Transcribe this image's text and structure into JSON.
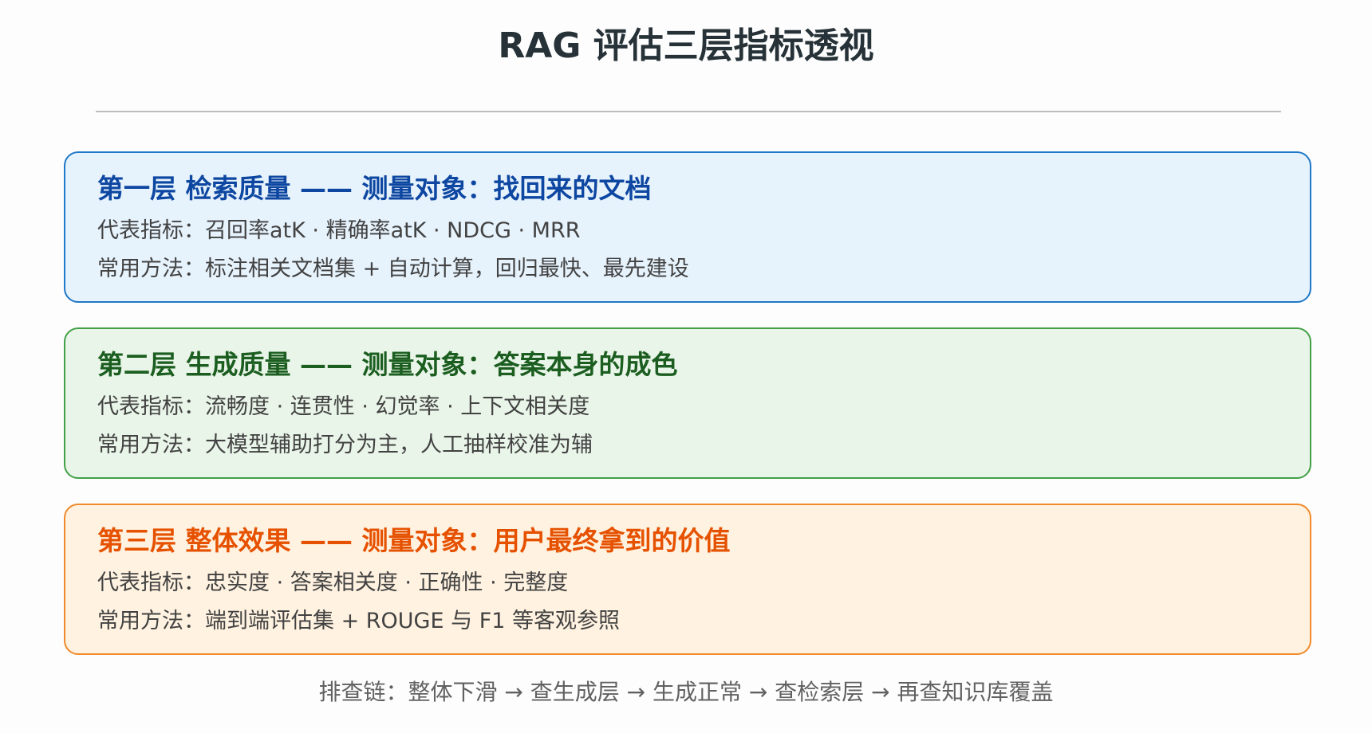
{
  "title": "RAG 评估三层指标透视",
  "layers": [
    {
      "title": "第一层 检索质量 —— 测量对象：找回来的文档",
      "metrics": "代表指标：召回率atK · 精确率atK · NDCG · MRR",
      "method": "常用方法：标注相关文档集 + 自动计算，回归最快、最先建设"
    },
    {
      "title": "第二层 生成质量 —— 测量对象：答案本身的成色",
      "metrics": "代表指标：流畅度 · 连贯性 · 幻觉率 · 上下文相关度",
      "method": "常用方法：大模型辅助打分为主，人工抽样校准为辅"
    },
    {
      "title": "第三层 整体效果 —— 测量对象：用户最终拿到的价值",
      "metrics": "代表指标：忠实度 · 答案相关度 · 正确性 · 完整度",
      "method": "常用方法：端到端评估集 + ROUGE 与 F1 等客观参照"
    }
  ],
  "footer": "排查链：整体下滑 → 查生成层 → 生成正常 → 查检索层 → 再查知识库覆盖",
  "colors": {
    "layer1_border": "#1f78c8",
    "layer2_border": "#43a047",
    "layer3_border": "#f08a2a"
  }
}
